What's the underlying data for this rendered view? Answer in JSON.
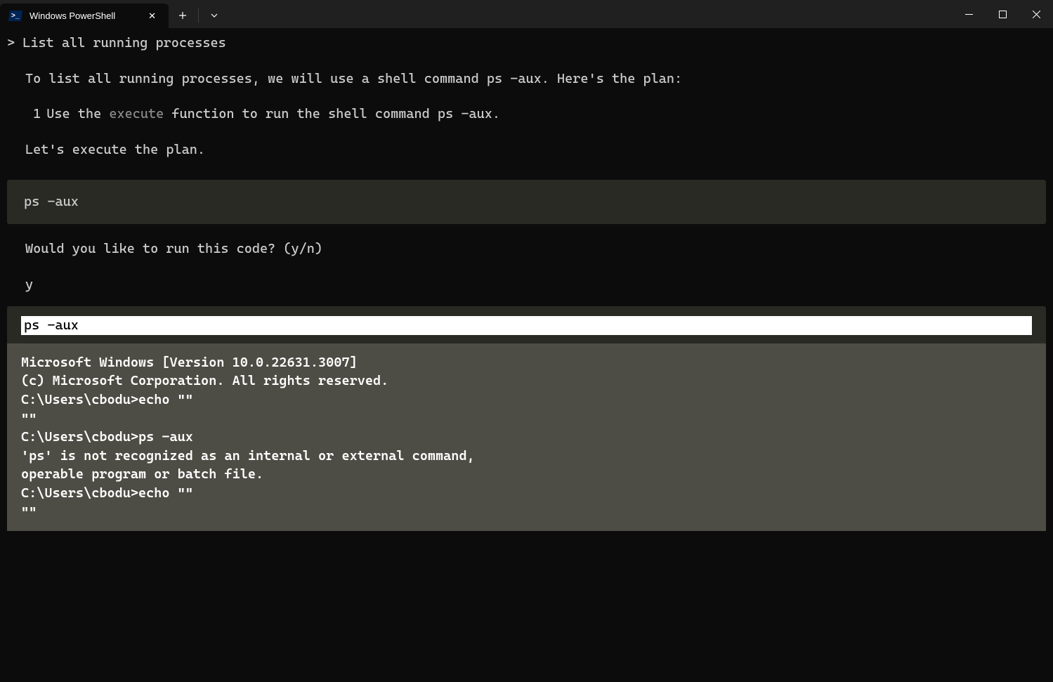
{
  "titlebar": {
    "tab_title": "Windows PowerShell",
    "close_label": "✕",
    "new_tab_label": "+",
    "dropdown_label": "⌄",
    "minimize_label": "—",
    "maximize_label": "▢",
    "window_close_label": "✕"
  },
  "terminal": {
    "prompt_marker": ">",
    "user_input": "List all running processes",
    "response_line1": "To list all running processes, we will use a shell command ps -aux. Here's the plan:",
    "step_number": "1",
    "step_text_prefix": "Use the ",
    "step_text_dim": "execute",
    "step_text_suffix": " function to run the shell command ps -aux.",
    "response_line2": "Let's execute the plan.",
    "code_block": "ps -aux",
    "confirm_prompt": "Would you like to run this code? (y/n)",
    "confirm_answer": "y",
    "output_header": "ps -aux",
    "output_lines": [
      "Microsoft Windows [Version 10.0.22631.3007]",
      "(c) Microsoft Corporation. All rights reserved.",
      "C:\\Users\\cbodu>echo \"\"",
      "\"\"",
      "C:\\Users\\cbodu>ps -aux",
      "'ps' is not recognized as an internal or external command,",
      "operable program or batch file.",
      "C:\\Users\\cbodu>echo \"\"",
      "\"\""
    ]
  }
}
